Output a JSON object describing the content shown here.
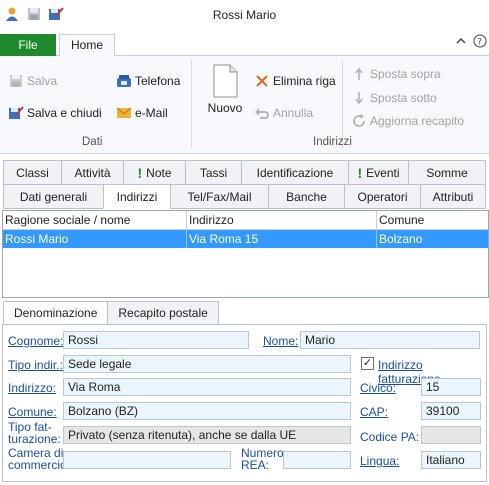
{
  "window": {
    "title": "Rossi Mario"
  },
  "ribbon": {
    "tabs": {
      "file": "File",
      "home": "Home"
    },
    "dati": {
      "label": "Dati",
      "salva": "Salva",
      "salva_chiudi": "Salva e chiudi",
      "telefona": "Telefona",
      "email": "e-Mail"
    },
    "indirizzi": {
      "label": "Indirizzi",
      "nuovo": "Nuovo",
      "elimina_riga": "Elimina riga",
      "annulla": "Annulla",
      "sposta_sopra": "Sposta sopra",
      "sposta_sotto": "Sposta sotto",
      "aggiorna_recapito": "Aggiorna recapito"
    }
  },
  "main_tabs": {
    "row1": [
      "Classi",
      "Attività",
      "Note",
      "Tassi",
      "Identificazione",
      "Eventi",
      "Somme"
    ],
    "row2": [
      "Dati generali",
      "Indirizzi",
      "Tel/Fax/Mail",
      "Banche",
      "Operatori",
      "Attributi"
    ],
    "active": "Indirizzi"
  },
  "grid": {
    "headers": [
      "Ragione sociale / nome",
      "Indirizzo",
      "Comune"
    ],
    "rows": [
      [
        "Rossi Mario",
        "Via Roma 15",
        "Bolzano"
      ]
    ]
  },
  "subtabs": [
    "Denominazione",
    "Recapito postale"
  ],
  "form": {
    "cognome_label": "Cognome:",
    "cognome": "Rossi",
    "nome_label": "Nome:",
    "nome": "Mario",
    "tipo_indir_label": "Tipo indir.:",
    "tipo_indir": "Sede legale",
    "indirizzo_fatturazione_label": "Indirizzo fatturazione",
    "indirizzo_fatturazione_checked": true,
    "indirizzo_label": "Indirizzo:",
    "indirizzo": "Via Roma",
    "civico_label": "Civico:",
    "civico": "15",
    "comune_label": "Comune:",
    "comune": "Bolzano (BZ)",
    "cap_label": "CAP:",
    "cap": "39100",
    "tipo_fatt_label_1": "Tipo fat-",
    "tipo_fatt_label_2": "turazione:",
    "tipo_fatturazione": "Privato (senza ritenuta), anche se dalla UE",
    "codice_pa_label": "Codice PA:",
    "codice_pa": "",
    "camera_label_1": "Camera di",
    "camera_label_2": "commercio:",
    "camera": "",
    "rea_label_1": "Numero",
    "rea_label_2": "REA:",
    "rea": "",
    "lingua_label": "Lingua:",
    "lingua": "Italiano"
  }
}
